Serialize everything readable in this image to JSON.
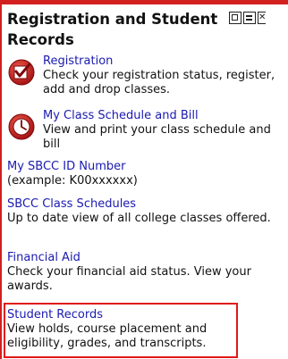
{
  "portlet": {
    "title": "Registration and Student Records",
    "controls": [
      "minimize-icon",
      "maximize-icon",
      "close-icon"
    ]
  },
  "items": [
    {
      "link": "Registration",
      "desc": "Check your registration status, register, add and drop classes.",
      "icon": "registration-check-icon"
    },
    {
      "link": "My Class Schedule and Bill",
      "desc": "View and print your class schedule and bill",
      "icon": "clock-icon"
    },
    {
      "link": "My SBCC ID Number",
      "desc": "(example: K00xxxxxx)"
    },
    {
      "link": "SBCC Class Schedules",
      "desc": "Up to date view of all college classes offered."
    },
    {
      "link": "Financial Aid",
      "desc": "Check your financial aid status. View your awards."
    },
    {
      "link": "Student Records",
      "desc": "View holds, course placement and eligibility, grades, and transcripts."
    }
  ],
  "colors": {
    "accent": "#d21f1f",
    "link": "#1a1ab0",
    "highlight": "#e01818"
  }
}
